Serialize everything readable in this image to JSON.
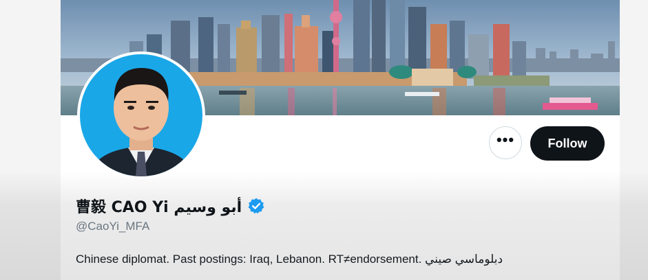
{
  "profile": {
    "display_name": "曹毅 CAO Yi أبو وسيم",
    "handle": "@CaoYi_MFA",
    "bio": "Chinese diplomat. Past postings: Iraq, Lebanon. RT≠endorsement.  دبلوماسي صيني"
  },
  "actions": {
    "more_icon": "more-horizontal-icon",
    "more_label": "•••",
    "follow_label": "Follow"
  },
  "icons": {
    "verified": "verified-badge-icon"
  },
  "colors": {
    "follow_bg": "#0f1419",
    "verified_blue": "#1d9bf0",
    "avatar_bg": "#1aa7e8"
  }
}
